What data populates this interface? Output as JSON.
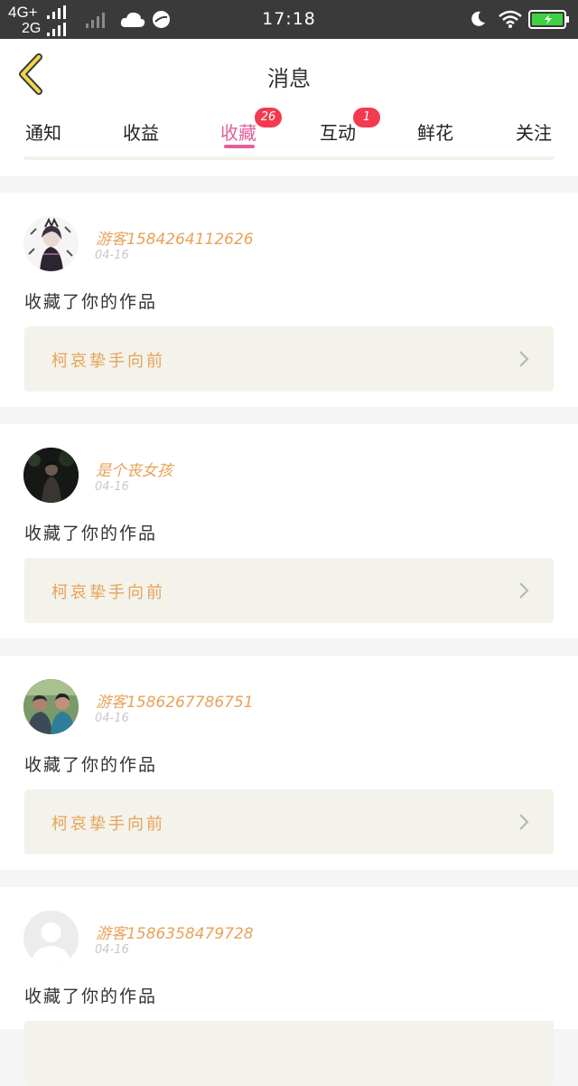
{
  "status_bar": {
    "net1": "4G+",
    "net2": "2G",
    "time": "17:18"
  },
  "header": {
    "title": "消息"
  },
  "tabs": [
    {
      "label": "通知",
      "badge": ""
    },
    {
      "label": "收益",
      "badge": ""
    },
    {
      "label": "收藏",
      "badge": "26"
    },
    {
      "label": "互动",
      "badge": "1"
    },
    {
      "label": "鲜花",
      "badge": ""
    },
    {
      "label": "关注",
      "badge": ""
    }
  ],
  "colors": {
    "accent": "#e0609a",
    "username": "#e8a25a",
    "badge": "#f33a4f",
    "card_bg": "#f3f3eb"
  },
  "messages": [
    {
      "username": "游客1584264112626",
      "date": "04-16",
      "action": "收藏了你的作品",
      "work_title": "柯哀挚手向前",
      "avatar": "dark-costume-avatar"
    },
    {
      "username": "是个丧女孩",
      "date": "04-16",
      "action": "收藏了你的作品",
      "work_title": "柯哀挚手向前",
      "avatar": "night-photo-avatar"
    },
    {
      "username": "游客1586267786751",
      "date": "04-16",
      "action": "收藏了你的作品",
      "work_title": "柯哀挚手向前",
      "avatar": "couple-photo-avatar"
    },
    {
      "username": "游客1586358479728",
      "date": "04-16",
      "action": "收藏了你的作品",
      "work_title": "",
      "avatar": "default-avatar"
    }
  ]
}
